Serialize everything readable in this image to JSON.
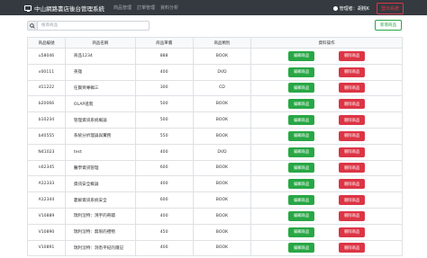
{
  "navbar": {
    "brand": "中山網路書店後台管理系統",
    "links": [
      "商品管理",
      "訂單管理",
      "資料分析"
    ],
    "user_label": "管理者：胡桃K",
    "logout_label": "登出系統"
  },
  "search": {
    "placeholder": "搜尋商品"
  },
  "add_button": "新增商品",
  "table": {
    "headers": [
      "商品編號",
      "商品名稱",
      "商品單價",
      "商品類別",
      "資料操作"
    ],
    "edit_label": "編輯商品",
    "delete_label": "刪除商品",
    "rows": [
      {
        "id": "u58046",
        "name": "商品1234",
        "price": "888",
        "category": "BOOK"
      },
      {
        "id": "v00111",
        "name": "英雄",
        "price": "400",
        "category": "DVD"
      },
      {
        "id": "d11222",
        "name": "任賢齊專輯三",
        "price": "300",
        "category": "CD"
      },
      {
        "id": "b20066",
        "name": "OLAP進階",
        "price": "500",
        "category": "BOOK"
      },
      {
        "id": "b10234",
        "name": "管理資訊系統概論",
        "price": "500",
        "category": "BOOK"
      },
      {
        "id": "b40555",
        "name": "系統分析理論與實務",
        "price": "550",
        "category": "BOOK"
      },
      {
        "id": "N41023",
        "name": "test",
        "price": "400",
        "category": "DVD"
      },
      {
        "id": "n02345",
        "name": "醫學資訊管理",
        "price": "600",
        "category": "BOOK"
      },
      {
        "id": "A12333",
        "name": "資訊安全概論",
        "price": "400",
        "category": "BOOK"
      },
      {
        "id": "A12344",
        "name": "叢解資訊系統安全",
        "price": "600",
        "category": "BOOK"
      },
      {
        "id": "V10889",
        "name": "瑞利涅特：鴻宇的奇蹟",
        "price": "400",
        "category": "BOOK"
      },
      {
        "id": "V10890",
        "name": "瑞利涅特：無限的禮物",
        "price": "450",
        "category": "BOOK"
      },
      {
        "id": "V10891",
        "name": "瑞利涅特：洞悉平紀的隱記",
        "price": "400",
        "category": "BOOK"
      }
    ]
  },
  "colors": {
    "navbar": "#343a40",
    "edit": "#28a745",
    "delete": "#dc3545"
  }
}
